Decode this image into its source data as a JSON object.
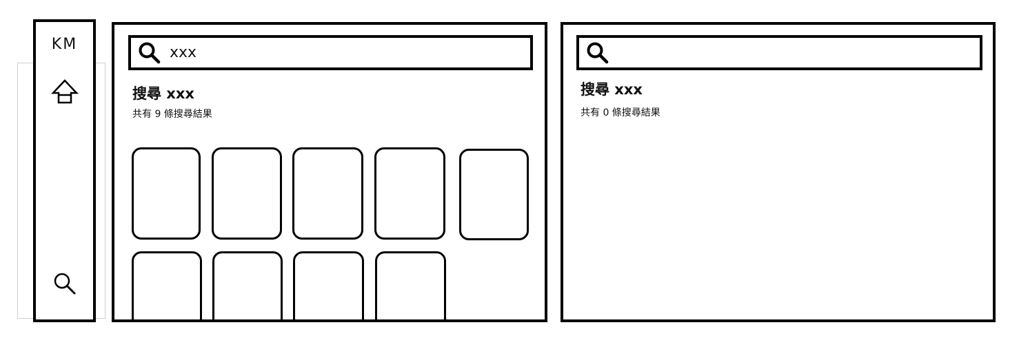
{
  "sidebar": {
    "logo": "KM",
    "items": [
      {
        "icon": "home-icon"
      },
      {
        "icon": "search-icon"
      }
    ]
  },
  "panels": [
    {
      "search_value": "xxx",
      "title": "搜尋 xxx",
      "count_text": "共有 9 條搜尋結果",
      "result_count": 9
    },
    {
      "search_value": "",
      "title": "搜尋 xxx",
      "count_text": "共有 0 條搜尋結果",
      "result_count": 0
    }
  ]
}
